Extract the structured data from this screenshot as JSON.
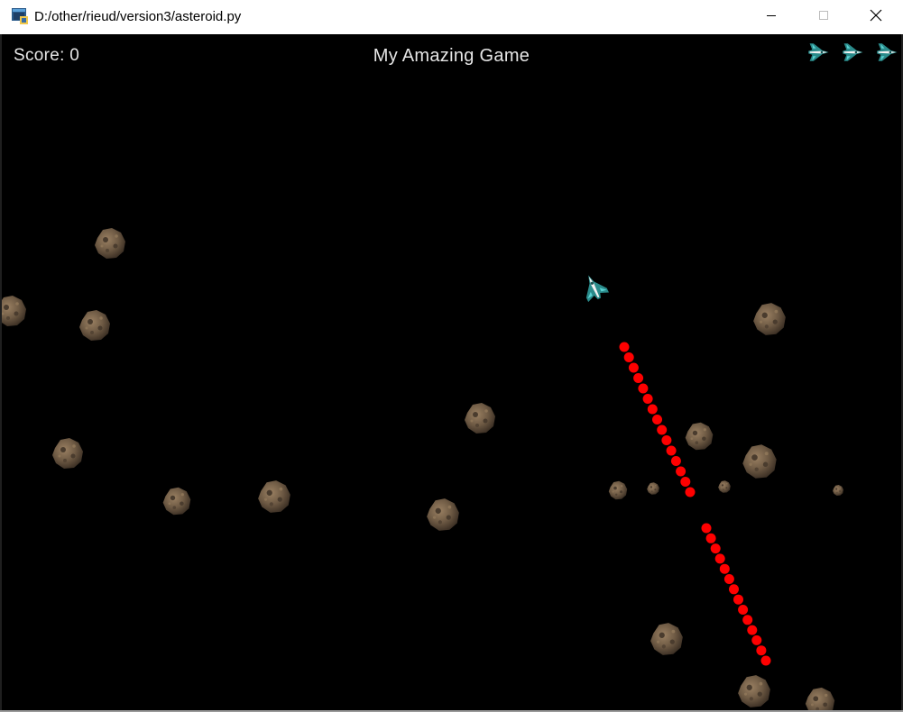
{
  "window": {
    "title": "D:/other/rieud/version3/asteroid.py",
    "app_icon": "python-icon",
    "controls": {
      "minimize_icon": "minimize-icon",
      "maximize_icon": "maximize-icon",
      "close_icon": "close-icon"
    }
  },
  "hud": {
    "score_text": "Score: 0",
    "game_title": "My Amazing Game",
    "lives_remaining": 3,
    "life_icon": "spaceship-icon"
  },
  "game": {
    "background_color": "#000000",
    "player_ship_icon": "spaceship-icon",
    "bullet_color": "#ff0000",
    "asteroid_color": "#6e5a44",
    "asteroid_count": 20,
    "bullet_count": 29
  }
}
